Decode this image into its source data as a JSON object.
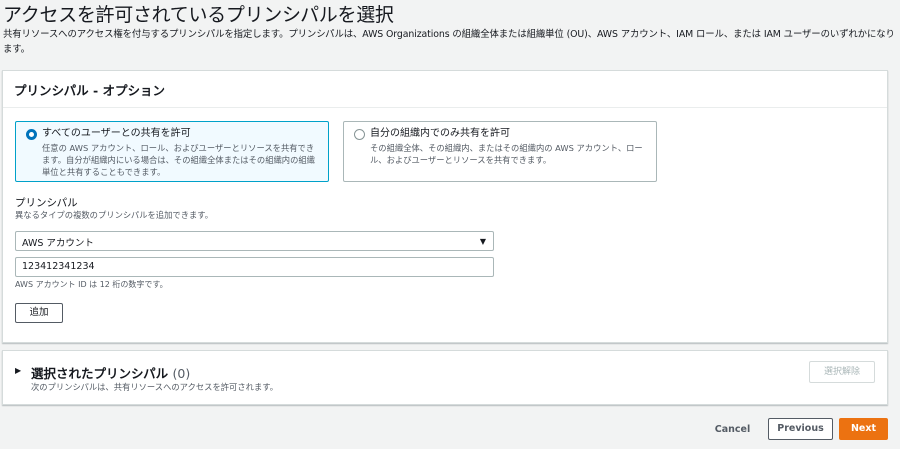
{
  "page": {
    "title": "アクセスを許可されているプリンシパルを選択",
    "description": "共有リソースへのアクセス権を付与するプリンシパルを指定します。プリンシパルは、AWS Organizations の組織全体または組織単位 (OU)、AWS アカウント、IAM ロール、または IAM ユーザーのいずれかになります。"
  },
  "options_card": {
    "title": "プリンシパル - オプション",
    "tiles": [
      {
        "label": "すべてのユーザーとの共有を許可",
        "description": "任意の AWS アカウント、ロール、およびユーザーとリソースを共有できます。自分が組織内にいる場合は、その組織全体またはその組織内の組織単位と共有することもできます。",
        "selected": true
      },
      {
        "label": "自分の組織内でのみ共有を許可",
        "description": "その組織全体、その組織内、またはその組織内の AWS アカウント、ロール、およびユーザーとリソースを共有できます。",
        "selected": false
      }
    ],
    "principal_label": "プリンシパル",
    "principal_help": "異なるタイプの複数のプリンシパルを追加できます。",
    "principal_type_selected": "AWS アカウント",
    "account_id_value": "123412341234",
    "account_id_help": "AWS アカウント ID は 12 桁の数字です。",
    "add_button": "追加"
  },
  "selected_card": {
    "title": "選択されたプリンシパル",
    "count": "(0)",
    "description": "次のプリンシパルは、共有リソースへのアクセスを許可されます。",
    "remove_button": "選択解除"
  },
  "footer": {
    "cancel": "Cancel",
    "previous": "Previous",
    "next": "Next"
  },
  "colors": {
    "accent": "#ec7211",
    "selected_border": "#00a1c9",
    "radio": "#0073bb"
  },
  "icons": {
    "select_caret": "▼",
    "expand": "▶"
  }
}
